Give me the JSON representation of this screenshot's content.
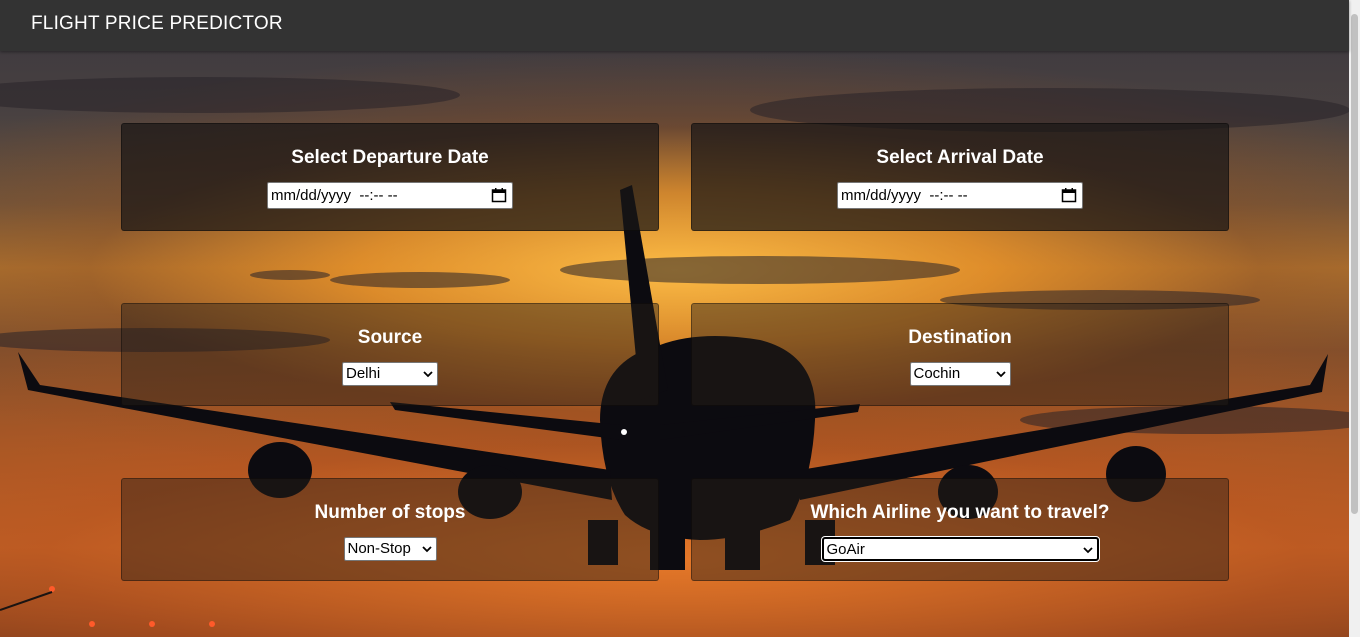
{
  "navbar": {
    "brand": "FLIGHT PRICE PREDICTOR"
  },
  "form": {
    "departure": {
      "label": "Select Departure Date",
      "value": "mm/dd/yyyy  --:-- --"
    },
    "arrival": {
      "label": "Select Arrival Date",
      "value": "mm/dd/yyyy  --:-- --"
    },
    "source": {
      "label": "Source",
      "selected": "Delhi"
    },
    "destination": {
      "label": "Destination",
      "selected": "Cochin"
    },
    "stops": {
      "label": "Number of stops",
      "selected": "Non-Stop"
    },
    "airline": {
      "label": "Which Airline you want to travel?",
      "selected": "GoAir"
    }
  },
  "icons": {
    "date_picker": "calendar-icon",
    "dropdown": "chevron-down-icon"
  },
  "colors": {
    "navbar_bg": "#333333",
    "panel_text": "#ffffff"
  }
}
